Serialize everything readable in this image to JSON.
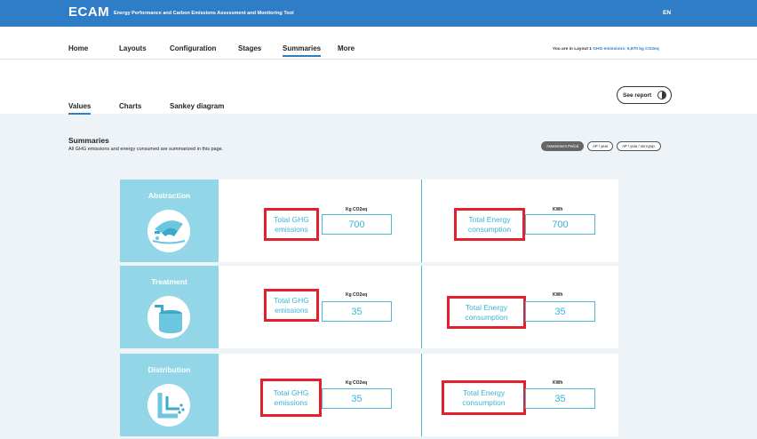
{
  "header": {
    "brand": "ECAM",
    "subtitle": "Energy Performance and Carbon Emissions Assessment and Monitoring Tool",
    "lang": "EN"
  },
  "nav": {
    "items": [
      "Home",
      "Layouts",
      "Configuration",
      "Stages",
      "Summaries",
      "More"
    ],
    "active": "Summaries",
    "layout_prefix": "You are in",
    "layout_name": "Layout 1",
    "layout_emissions": "GHG emissions: 6,870 kg CO2eq"
  },
  "subnav": {
    "tabs": [
      "Values",
      "Charts",
      "Sankey diagram"
    ],
    "active": "Values",
    "see_report": "See report"
  },
  "summary": {
    "title": "Summaries",
    "description": "All GHG emissions and energy consumed are summarized in this page.",
    "pills": [
      "Assessment Period",
      "AP / year",
      "AP / year / serv.pop."
    ]
  },
  "stages": [
    {
      "name": "Abstraction",
      "icon": "abstraction-icon",
      "ghg_label": "Total GHG emissions",
      "ghg_unit": "Kg CO2eq",
      "ghg_value": "700",
      "energy_label": "Total Energy consumption",
      "energy_unit": "KWh",
      "energy_value": "700"
    },
    {
      "name": "Treatment",
      "icon": "treatment-icon",
      "ghg_label": "Total GHG emissions",
      "ghg_unit": "Kg CO2eq",
      "ghg_value": "35",
      "energy_label": "Total Energy consumption",
      "energy_unit": "KWh",
      "energy_value": "35"
    },
    {
      "name": "Distribution",
      "icon": "distribution-icon",
      "ghg_label": "Total GHG emissions",
      "ghg_unit": "Kg CO2eq",
      "ghg_value": "35",
      "energy_label": "Total Energy consumption",
      "energy_unit": "KWh",
      "energy_value": "35"
    }
  ],
  "colors": {
    "brand": "#2f7dc7",
    "stage_panel": "#93d6e8",
    "value_text": "#3bb3d6",
    "highlight": "#e5202e"
  }
}
